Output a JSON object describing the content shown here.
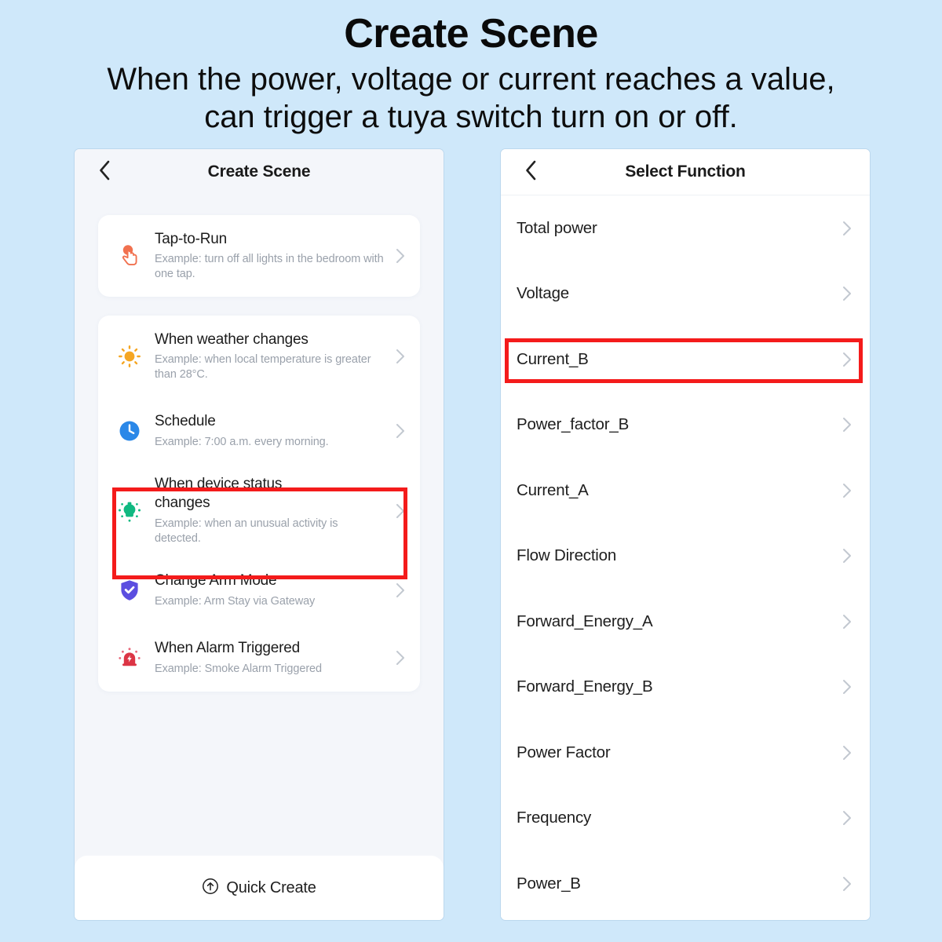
{
  "header": {
    "title": "Create Scene",
    "subtitle_line1": "When the power, voltage or current reaches a value,",
    "subtitle_line2": "can trigger a tuya switch turn on or off."
  },
  "colors": {
    "background": "#cfe8fa",
    "highlight_red": "#f41b1b",
    "panel_bg": "#f4f6fa",
    "card_bg": "#ffffff",
    "icon_tap": "#f1714f",
    "icon_weather": "#f5a623",
    "icon_schedule": "#2b88e8",
    "icon_device": "#10b981",
    "icon_arm": "#5b4ee0",
    "icon_alarm": "#dc3545"
  },
  "left_phone": {
    "nav": {
      "title": "Create Scene",
      "back_icon": "chevron-left-icon"
    },
    "card_one": {
      "items": [
        {
          "title": "Tap-to-Run",
          "desc": "Example: turn off all lights in the bedroom with one tap.",
          "icon": "hand-tap-icon",
          "highlighted": false
        }
      ]
    },
    "card_two": {
      "items": [
        {
          "title": "When weather changes",
          "desc": "Example: when local temperature is greater than 28°C.",
          "icon": "sun-icon",
          "highlighted": false
        },
        {
          "title": "Schedule",
          "desc": "Example: 7:00 a.m. every morning.",
          "icon": "clock-icon",
          "highlighted": false
        },
        {
          "title": "When device status changes",
          "desc": "Example: when an unusual activity is detected.",
          "icon": "bulb-icon",
          "highlighted": true
        },
        {
          "title": "Change Arm Mode",
          "desc": "Example: Arm Stay via Gateway",
          "icon": "shield-check-icon",
          "highlighted": false
        },
        {
          "title": "When Alarm Triggered",
          "desc": "Example: Smoke Alarm Triggered",
          "icon": "siren-icon",
          "highlighted": false
        }
      ]
    },
    "footer": {
      "quick_create_label": "Quick Create",
      "quick_create_icon": "arrow-up-circle-icon"
    }
  },
  "right_phone": {
    "nav": {
      "title": "Select Function",
      "back_icon": "chevron-left-icon"
    },
    "functions": [
      {
        "label": "Total power",
        "highlighted": false
      },
      {
        "label": "Voltage",
        "highlighted": false
      },
      {
        "label": "Current_B",
        "highlighted": true
      },
      {
        "label": "Power_factor_B",
        "highlighted": false
      },
      {
        "label": "Current_A",
        "highlighted": false
      },
      {
        "label": "Flow Direction",
        "highlighted": false
      },
      {
        "label": "Forward_Energy_A",
        "highlighted": false
      },
      {
        "label": "Forward_Energy_B",
        "highlighted": false
      },
      {
        "label": "Power Factor",
        "highlighted": false
      },
      {
        "label": "Frequency",
        "highlighted": false
      },
      {
        "label": "Power_B",
        "highlighted": false
      }
    ]
  }
}
